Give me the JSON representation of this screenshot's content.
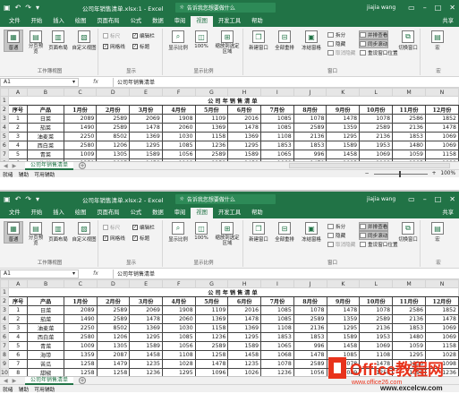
{
  "colors": {
    "brand": "#217346",
    "ribbon_bg": "#f3f3f3",
    "watermark_red": "#e8331c",
    "watermark_orange": "#f39c12"
  },
  "windows": [
    {
      "id": "w1",
      "title": "公司年销售清单.xlsx:1 - Excel",
      "tell_me": "告诉我您想要做什么",
      "user": "jiajia wang",
      "selected_view": "normal"
    },
    {
      "id": "w2",
      "title": "公司年销售清单.xlsx:2 - Excel",
      "tell_me": "告诉我您想要做什么",
      "user": "jiajia wang",
      "selected_view": "normal"
    }
  ],
  "tabs": [
    "文件",
    "开始",
    "插入",
    "绘图",
    "页面布局",
    "公式",
    "数据",
    "审阅",
    "视图",
    "开发工具",
    "帮助"
  ],
  "active_tab": "视图",
  "share_label": "共享",
  "ribbon": {
    "workbook_views": {
      "label": "工作簿视图",
      "normal": "普通",
      "page_break": "分页预览",
      "page_layout": "页面布局",
      "custom": "自定义视图"
    },
    "show": {
      "label": "显示",
      "ruler": "标尺",
      "gridlines": "网格线",
      "formula_bar": "编辑栏",
      "headings": "标题"
    },
    "zoom": {
      "label": "显示比例",
      "zoom": "显示比例",
      "hundred": "100%",
      "to_selection": "缩放到选定区域"
    },
    "window": {
      "label": "窗口",
      "new_window": "新建窗口",
      "arrange_all": "全部重排",
      "freeze": "冻结窗格",
      "split": "拆分",
      "hide": "隐藏",
      "unhide": "取消隐藏",
      "side_by_side": "并排查看",
      "sync_scroll": "同步滚动",
      "reset_pos": "重设窗口位置",
      "switch": "切换窗口"
    },
    "macros": {
      "label": "宏",
      "macros": "宏"
    }
  },
  "formula_bar": {
    "name_box": "A1",
    "fx": "fx",
    "content": "公司年销售清单"
  },
  "columns": [
    "A",
    "B",
    "C",
    "D",
    "E",
    "F",
    "G",
    "H",
    "I",
    "J",
    "K",
    "L",
    "M",
    "N"
  ],
  "sheet": {
    "title": "公司年销售清单",
    "headers": [
      "序号",
      "产品",
      "1月份",
      "2月份",
      "3月份",
      "4月份",
      "5月份",
      "6月份",
      "7月份",
      "8月份",
      "9月份",
      "10月份",
      "11月份",
      "12月份"
    ],
    "rows": [
      [
        "1",
        "日菜",
        "2089",
        "2589",
        "2069",
        "1908",
        "1109",
        "2016",
        "1085",
        "1078",
        "1478",
        "1078",
        "2586",
        "1852"
      ],
      [
        "2",
        "茄菜",
        "1490",
        "2589",
        "1478",
        "2060",
        "1369",
        "1478",
        "1085",
        "2589",
        "1359",
        "2589",
        "2136",
        "1478"
      ],
      [
        "3",
        "油麦菜",
        "2250",
        "8502",
        "1369",
        "1030",
        "1158",
        "1369",
        "1108",
        "2136",
        "1295",
        "2136",
        "1853",
        "1069"
      ],
      [
        "4",
        "西白菜",
        "2580",
        "1206",
        "1295",
        "1085",
        "1236",
        "1295",
        "1853",
        "1853",
        "1589",
        "1953",
        "1480",
        "1069"
      ],
      [
        "5",
        "青菜",
        "1009",
        "1305",
        "1589",
        "1056",
        "2589",
        "1589",
        "1065",
        "996",
        "1458",
        "1069",
        "1059",
        "1158"
      ],
      [
        "6",
        "海带",
        "1359",
        "2087",
        "1458",
        "1108",
        "1258",
        "1458",
        "1068",
        "1478",
        "1085",
        "1108",
        "1295",
        "1028"
      ],
      [
        "7",
        "苦瓜",
        "1258",
        "1479",
        "1235",
        "1028",
        "1478",
        "1235",
        "1078",
        "2589",
        "1078",
        "1478",
        "1236",
        "1098"
      ],
      [
        "8",
        "甜椒",
        "1258",
        "1258",
        "1236",
        "1295",
        "1096",
        "1026",
        "1236",
        "1056",
        "1089",
        "1256",
        "1096",
        "1236"
      ]
    ]
  },
  "sheet_tab": "公司年销售清单",
  "status": {
    "ready": "就绪",
    "helper": "辅助",
    "accessibility": "可用辅助",
    "zoom": "100%"
  },
  "watermark": {
    "brand": "Office教程网",
    "url": "www.office26.com",
    "url2": "www.excelcw.com"
  }
}
